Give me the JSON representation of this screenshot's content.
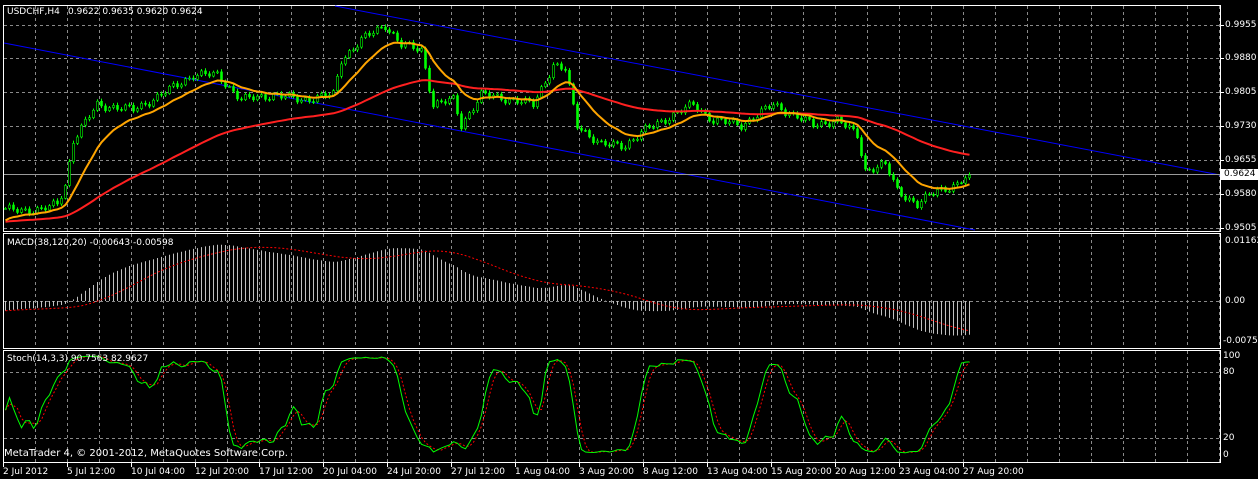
{
  "header": {
    "symbol_label": "USDCHF,H4",
    "ohlc": "0.9622 0.9635 0.9620 0.9624"
  },
  "macd": {
    "label": "MACD(38,120,20) -0.00643 -0.00598",
    "axis": [
      "0.01162",
      "0.00",
      "-0.00753"
    ],
    "max": 0.01162,
    "min": -0.00753
  },
  "stoch": {
    "label": "Stoch(14,3,3) 90.7563 82.9627",
    "axis": [
      "100",
      "80",
      "20",
      "0"
    ]
  },
  "copyright": "MetaTrader 4, © 2001-2012, MetaQuotes Software Corp.",
  "price_axis": [
    "0.9955",
    "0.9880",
    "0.9805",
    "0.9730",
    "0.9655",
    "0.9580",
    "0.9505"
  ],
  "current_price": "0.9624",
  "dates": [
    "2 Jul 2012",
    "5 Jul 12:00",
    "10 Jul 04:00",
    "12 Jul 20:00",
    "17 Jul 12:00",
    "20 Jul 04:00",
    "24 Jul 20:00",
    "27 Jul 12:00",
    "1 Aug 04:00",
    "3 Aug 20:00",
    "8 Aug 12:00",
    "13 Aug 04:00",
    "15 Aug 20:00",
    "20 Aug 12:00",
    "23 Aug 04:00",
    "27 Aug 20:00"
  ],
  "colors": {
    "bull": "#00ff00",
    "fast_ma": "#ffa500",
    "slow_ma": "#ff2020",
    "channel": "#0000ff",
    "grid": "#8a8a8a",
    "signal": "#ff0000",
    "hist": "#c0c0c0"
  },
  "chart_data": {
    "type": "line",
    "title": "USDCHF,H4",
    "ylim": [
      0.9505,
      0.9955
    ],
    "anchors_bar_index": [
      0,
      9,
      13,
      15,
      17,
      23,
      32,
      39,
      47,
      53,
      59,
      67,
      74,
      82,
      84,
      89,
      95,
      99,
      104,
      107,
      112,
      114,
      119,
      127,
      132,
      137,
      140,
      143,
      149,
      155,
      160,
      167,
      172,
      177,
      184,
      192,
      197,
      202,
      208,
      213,
      215,
      220,
      223,
      228,
      233,
      238,
      241
    ],
    "anchors_close": [
      0.9547,
      0.9547,
      0.956,
      0.9602,
      0.9701,
      0.9779,
      0.9768,
      0.9801,
      0.9845,
      0.9845,
      0.979,
      0.9801,
      0.979,
      0.9801,
      0.9878,
      0.9922,
      0.9955,
      0.9911,
      0.99,
      0.9779,
      0.979,
      0.9734,
      0.9801,
      0.979,
      0.9779,
      0.9867,
      0.9856,
      0.9734,
      0.969,
      0.969,
      0.9723,
      0.9757,
      0.9779,
      0.9745,
      0.9734,
      0.9779,
      0.9757,
      0.9734,
      0.9745,
      0.9712,
      0.9635,
      0.9646,
      0.9591,
      0.9558,
      0.9591,
      0.9602,
      0.9624
    ]
  }
}
